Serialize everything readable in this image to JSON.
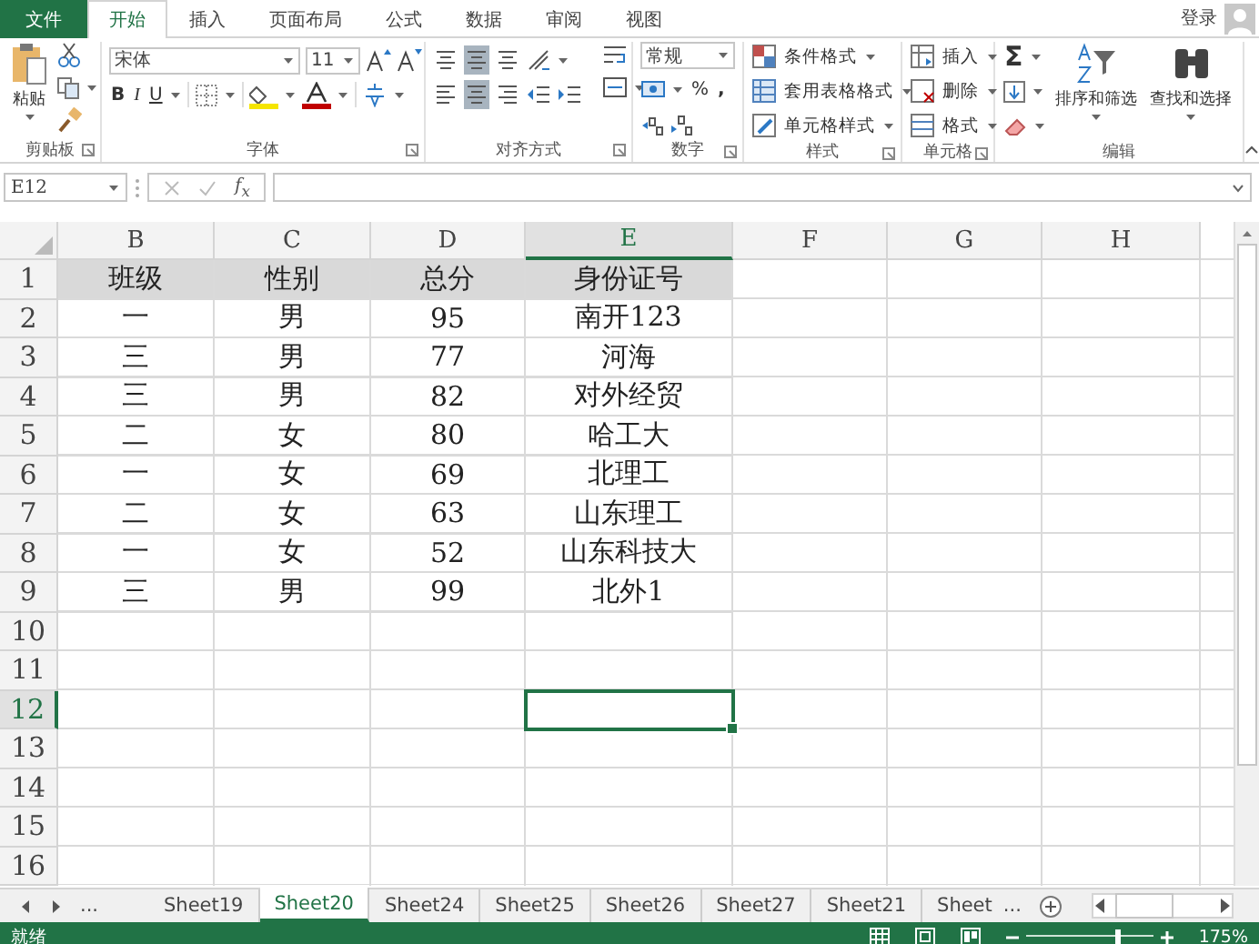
{
  "ribbon_tabs": [
    {
      "label": "文件",
      "kind": "file",
      "selected": false
    },
    {
      "label": "开始",
      "kind": "tab",
      "selected": true
    },
    {
      "label": "插入",
      "kind": "tab",
      "selected": false
    },
    {
      "label": "页面布局",
      "kind": "tab",
      "selected": false
    },
    {
      "label": "公式",
      "kind": "tab",
      "selected": false
    },
    {
      "label": "数据",
      "kind": "tab",
      "selected": false
    },
    {
      "label": "审阅",
      "kind": "tab",
      "selected": false
    },
    {
      "label": "视图",
      "kind": "tab",
      "selected": false
    }
  ],
  "account": {
    "label": "登录"
  },
  "clipboard": {
    "paste": "粘贴",
    "group": "剪贴板"
  },
  "font": {
    "name": "宋体",
    "size": "11",
    "bold": "B",
    "italic": "I",
    "underline": "U",
    "group": "字体"
  },
  "alignment": {
    "group": "对齐方式"
  },
  "number": {
    "format": "常规",
    "percent": "%",
    "comma": ",",
    "group": "数字"
  },
  "styles": {
    "items": [
      "条件格式",
      "套用表格格式",
      "单元格样式"
    ],
    "group": "样式"
  },
  "cells": {
    "items": [
      "插入",
      "删除",
      "格式"
    ],
    "group": "单元格"
  },
  "editing": {
    "sigma": "Σ",
    "buttons": [
      "排序和筛选",
      "查找和选择"
    ],
    "group": "编辑"
  },
  "formula_bar": {
    "name_box": "E12",
    "fx": "f$_{x}$"
  },
  "sheet": {
    "columns": [
      {
        "label": "B",
        "selected": false
      },
      {
        "label": "C",
        "selected": false
      },
      {
        "label": "D",
        "selected": false
      },
      {
        "label": "E",
        "selected": true
      },
      {
        "label": "F",
        "selected": false
      },
      {
        "label": "G",
        "selected": false
      },
      {
        "label": "H",
        "selected": false
      }
    ],
    "rows": [
      {
        "label": "1",
        "kind": "header",
        "selected": false,
        "cells": [
          "班级",
          "性别",
          "总分",
          "身份证号"
        ]
      },
      {
        "label": "2",
        "kind": "data",
        "selected": false,
        "cells": [
          "一",
          "男",
          "95",
          "南开123"
        ]
      },
      {
        "label": "3",
        "kind": "data",
        "selected": false,
        "cells": [
          "三",
          "男",
          "77",
          "河海"
        ]
      },
      {
        "label": "4",
        "kind": "data",
        "selected": false,
        "cells": [
          "三",
          "男",
          "82",
          "对外经贸"
        ]
      },
      {
        "label": "5",
        "kind": "data",
        "selected": false,
        "cells": [
          "二",
          "女",
          "80",
          "哈工大"
        ]
      },
      {
        "label": "6",
        "kind": "data",
        "selected": false,
        "cells": [
          "一",
          "女",
          "69",
          "北理工"
        ]
      },
      {
        "label": "7",
        "kind": "data",
        "selected": false,
        "cells": [
          "二",
          "女",
          "63",
          "山东理工"
        ]
      },
      {
        "label": "8",
        "kind": "data",
        "selected": false,
        "cells": [
          "一",
          "女",
          "52",
          "山东科技大"
        ]
      },
      {
        "label": "9",
        "kind": "data",
        "selected": false,
        "cells": [
          "三",
          "男",
          "99",
          "北外1"
        ]
      },
      {
        "label": "10",
        "kind": "data",
        "selected": false
      },
      {
        "label": "11",
        "kind": "data",
        "selected": false
      },
      {
        "label": "12",
        "kind": "data",
        "selected": true
      },
      {
        "label": "13",
        "kind": "data",
        "selected": false
      },
      {
        "label": "14",
        "kind": "data",
        "selected": false
      },
      {
        "label": "15",
        "kind": "data",
        "selected": false
      },
      {
        "label": "16",
        "kind": "data",
        "selected": false
      }
    ]
  },
  "sheet_tabs": {
    "more_before": "...",
    "more_after": "...",
    "tabs": [
      {
        "label": "Sheet19",
        "selected": false
      },
      {
        "label": "Sheet20",
        "selected": true
      },
      {
        "label": "Sheet24",
        "selected": false
      },
      {
        "label": "Sheet25",
        "selected": false
      },
      {
        "label": "Sheet26",
        "selected": false
      },
      {
        "label": "Sheet27",
        "selected": false
      },
      {
        "label": "Sheet21",
        "selected": false
      },
      {
        "label": "Sheet",
        "selected": false
      }
    ]
  },
  "status_bar": {
    "status": "就绪",
    "zoom": "175%",
    "zoom_slider": {
      "level": 0.72
    }
  }
}
